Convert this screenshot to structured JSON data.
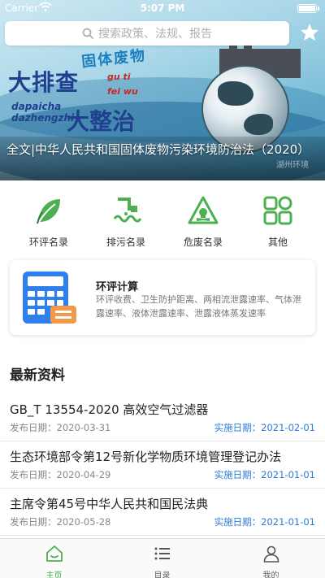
{
  "status_bar": {
    "carrier": "Carrier",
    "time": "5:07 PM"
  },
  "search": {
    "placeholder": "搜索政策、法规、报告"
  },
  "banner": {
    "tag": "固体废物",
    "headline_1": "大排查",
    "headline_2": "大整治",
    "pinyin_1": "dapaicha\ndazhengzhi",
    "pinyin_2": "gu ti\nfei wu",
    "caption": "全文|中华人民共和国固体废物污染环境防治法（2020）",
    "watermark": "湖州环境"
  },
  "menu": {
    "items": [
      {
        "label": "环评名录",
        "icon": "leaf-icon"
      },
      {
        "label": "排污名录",
        "icon": "pipe-discharge-icon"
      },
      {
        "label": "危废名录",
        "icon": "hazard-warning-icon"
      },
      {
        "label": "其他",
        "icon": "grid-icon"
      }
    ]
  },
  "calculator": {
    "title": "环评计算",
    "description": "环评收费、卫生防护距离、两相流泄露速率、气体泄露速率、液体泄露速率、泄露液体蒸发速率",
    "icon": "calculator-icon"
  },
  "latest": {
    "title": "最新资料",
    "items": [
      {
        "title": "GB_T 13554-2020 高效空气过滤器",
        "publish": "发布日期：2020-03-31",
        "implement": "实施日期：2021-02-01"
      },
      {
        "title": "生态环境部令第12号新化学物质环境管理登记办法",
        "publish": "发布日期：2020-04-29",
        "implement": "实施日期：2021-01-01"
      },
      {
        "title": "主席令第45号中华人民共和国民法典",
        "publish": "发布日期：2020-05-28",
        "implement": "实施日期：2021-01-01"
      }
    ]
  },
  "tabbar": {
    "tabs": [
      {
        "label": "主页",
        "icon": "home-icon",
        "active": true
      },
      {
        "label": "目录",
        "icon": "list-icon",
        "active": false
      },
      {
        "label": "我的",
        "icon": "user-icon",
        "active": false
      }
    ]
  },
  "colors": {
    "accent_green": "#4caf50",
    "link_blue": "#2a7bd6",
    "calc_blue": "#2f80ed",
    "calc_orange": "#f2994a"
  }
}
